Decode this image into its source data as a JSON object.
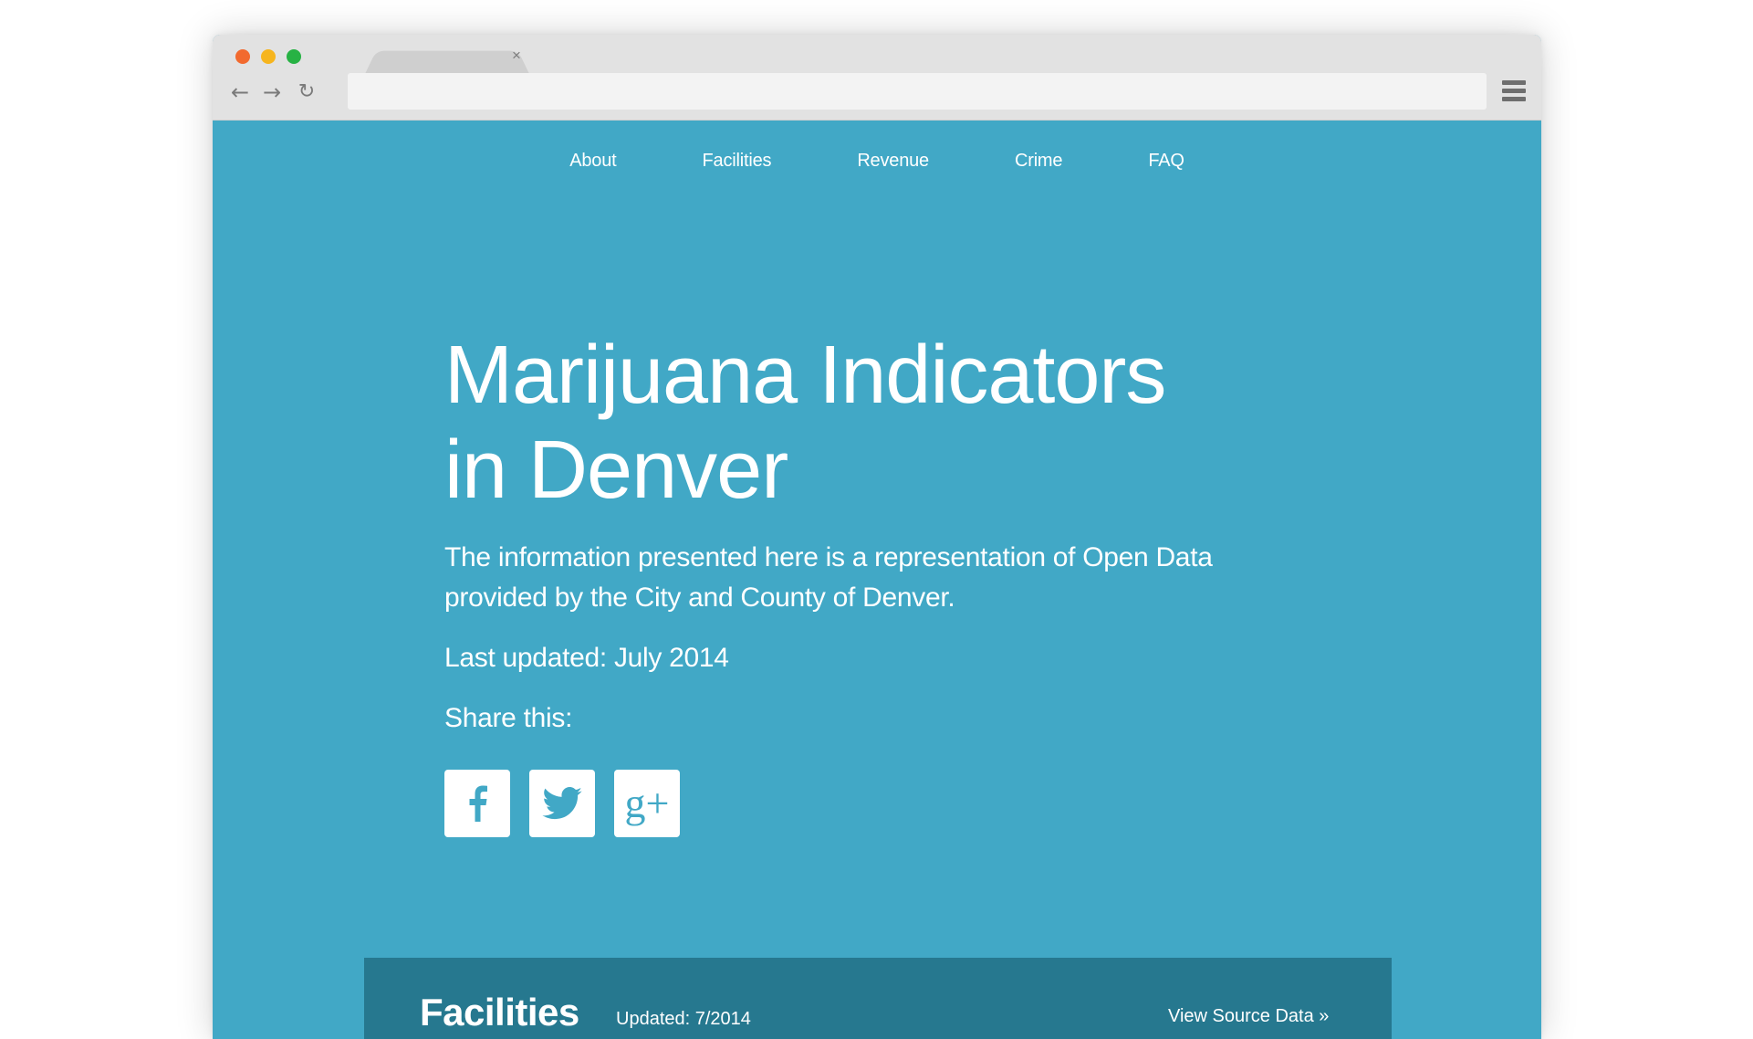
{
  "browser": {
    "tab_close": "×",
    "back": "←",
    "forward": "→",
    "reload": "↻",
    "address_value": ""
  },
  "nav": {
    "items": [
      {
        "label": "About"
      },
      {
        "label": "Facilities"
      },
      {
        "label": "Revenue"
      },
      {
        "label": "Crime"
      },
      {
        "label": "FAQ"
      }
    ]
  },
  "hero": {
    "title_line1": "Marijuana Indicators",
    "title_line2": "in Denver",
    "desc_line1": "The information presented here is a representation of Open Data",
    "desc_line2": "provided by the City and County of Denver.",
    "last_updated": "Last updated: July 2014",
    "share_label": "Share this:"
  },
  "social": [
    {
      "name": "facebook-icon",
      "glyph": "f"
    },
    {
      "name": "twitter-icon",
      "glyph": "bird"
    },
    {
      "name": "google-plus-icon",
      "glyph": "g+"
    }
  ],
  "panel": {
    "title": "Facilities",
    "updated": "Updated: 7/2014",
    "link": "View Source Data »"
  },
  "colors": {
    "page_bg": "#41a8c6",
    "panel_bg": "#26788f",
    "chrome_bg": "#e2e2e2"
  }
}
